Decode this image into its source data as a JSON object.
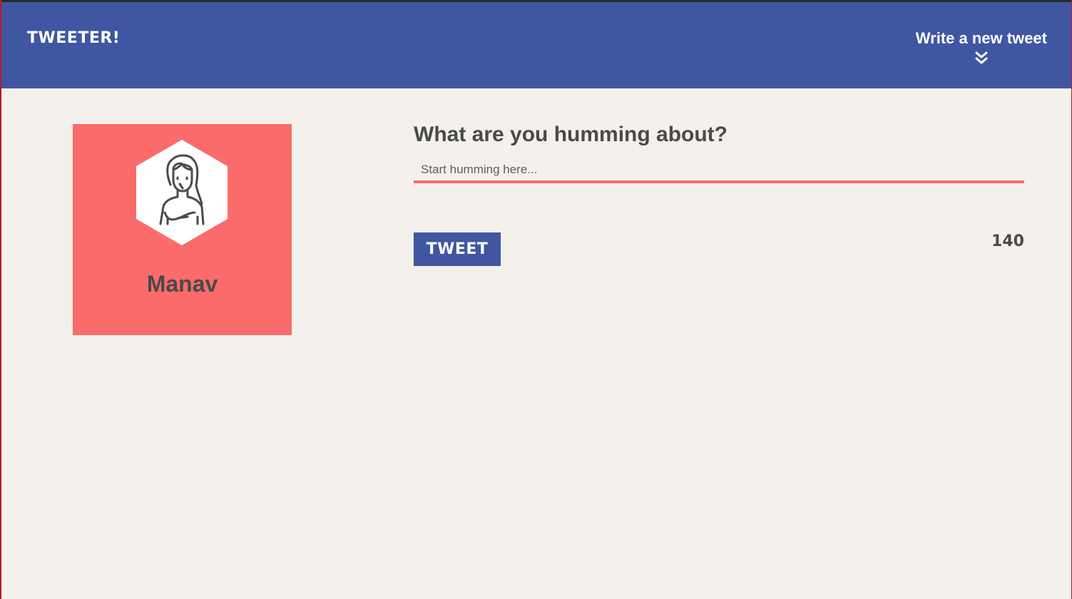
{
  "header": {
    "brand": "TWEETER!",
    "compose_label": "Write a new tweet",
    "compose_icon": "chevron-double-down-icon"
  },
  "profile": {
    "name": "Manav",
    "avatar_icon": "person-avatar-icon"
  },
  "composer": {
    "prompt": "What are you humming about?",
    "input_value": "",
    "input_placeholder": "Start humming here...",
    "tweet_button_label": "TWEET",
    "char_count": "140"
  },
  "colors": {
    "header_bg": "#4056a1",
    "page_bg": "#f4f1ec",
    "profile_bg": "#fc6b6b",
    "accent": "#fc6b6b",
    "text": "#4a4a48"
  }
}
